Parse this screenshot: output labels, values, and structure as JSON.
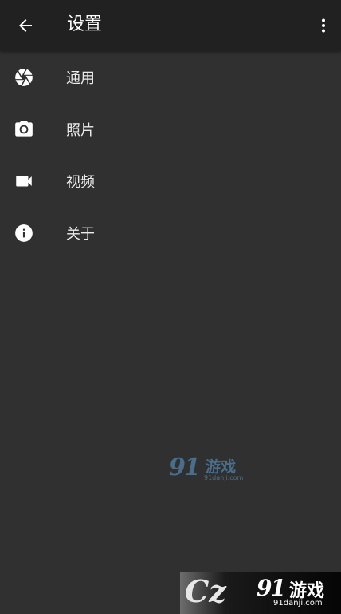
{
  "app_bar": {
    "title": "设置",
    "back_icon": "arrow-back-icon",
    "overflow_icon": "more-vert-icon"
  },
  "menu": {
    "items": [
      {
        "label": "通用",
        "icon": "aperture-icon"
      },
      {
        "label": "照片",
        "icon": "camera-icon"
      },
      {
        "label": "视频",
        "icon": "videocam-icon"
      },
      {
        "label": "关于",
        "icon": "info-icon"
      }
    ]
  },
  "watermarks": {
    "center": {
      "logo": "91",
      "text": "游戏",
      "url": "91danji.com"
    },
    "bottom": {
      "left_mark": "Cz",
      "logo": "91",
      "text": "游戏",
      "url": "91danji.com"
    }
  },
  "colors": {
    "app_bar_bg": "#212121",
    "page_bg": "#303030",
    "text": "#ffffff"
  }
}
